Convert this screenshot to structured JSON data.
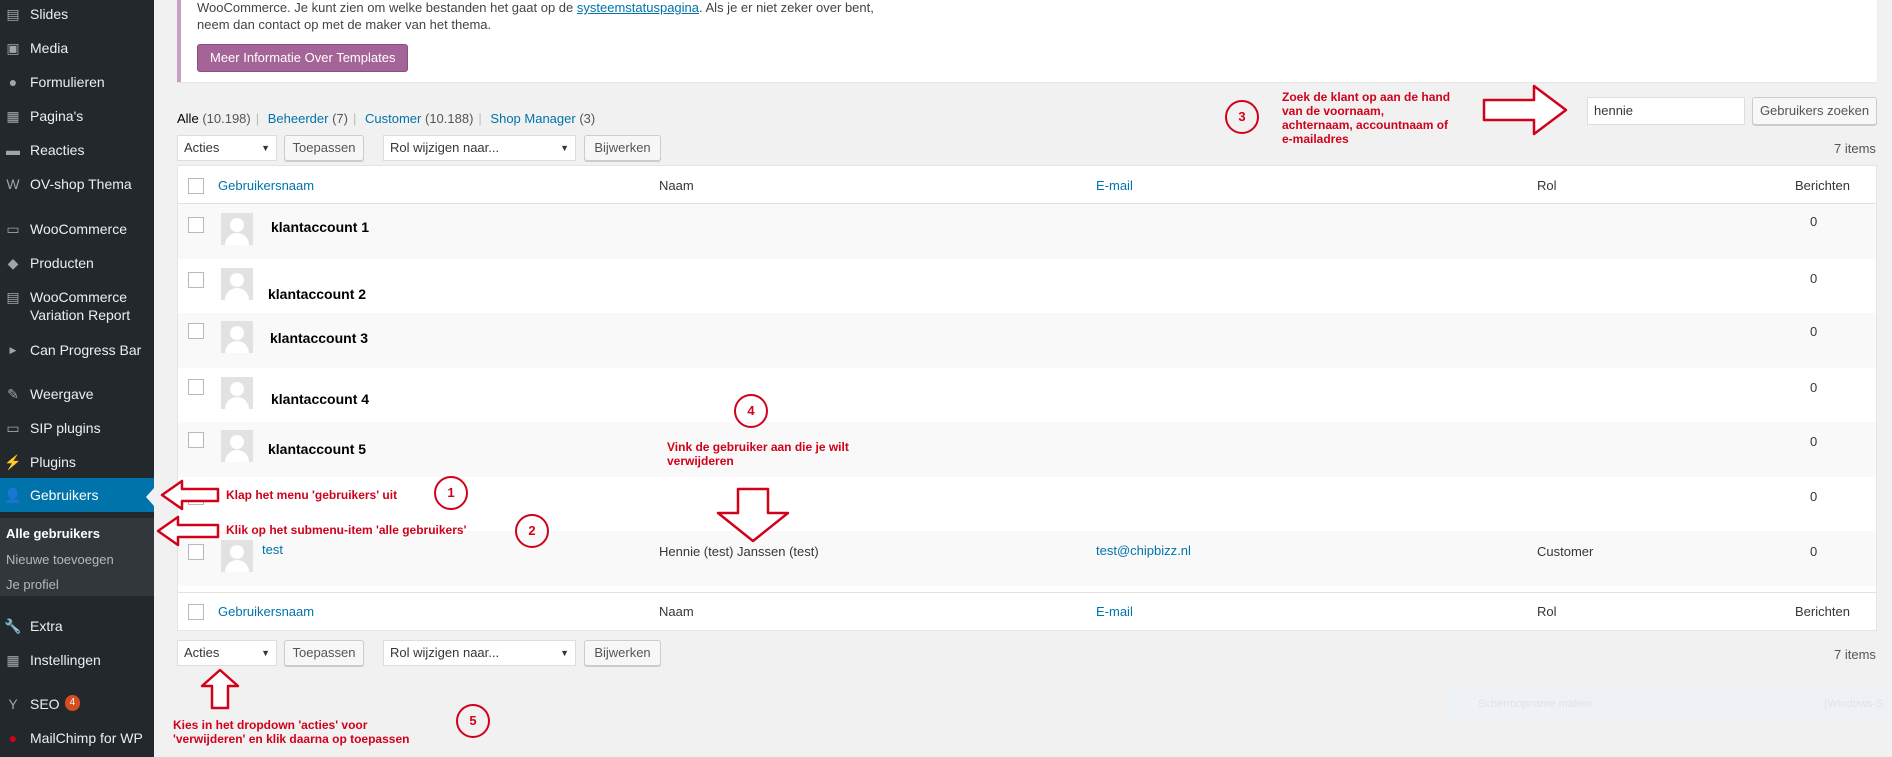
{
  "sidebar": {
    "items": [
      {
        "label": "Slides",
        "icon": "slides-icon"
      },
      {
        "label": "Media",
        "icon": "media-icon"
      },
      {
        "label": "Formulieren",
        "icon": "forms-icon"
      },
      {
        "label": "Pagina's",
        "icon": "pages-icon"
      },
      {
        "label": "Reacties",
        "icon": "comments-icon"
      },
      {
        "label": "OV-shop Thema",
        "icon": "theme-icon"
      },
      {
        "label": "WooCommerce",
        "icon": "woocommerce-icon"
      },
      {
        "label": "Producten",
        "icon": "products-icon"
      },
      {
        "label": "WooCommerce Variation Report",
        "icon": "report-icon"
      },
      {
        "label": "Can Progress Bar",
        "icon": "progress-icon"
      },
      {
        "label": "Weergave",
        "icon": "appearance-icon"
      },
      {
        "label": "SIP plugins",
        "icon": "sip-icon"
      },
      {
        "label": "Plugins",
        "icon": "plugins-icon"
      },
      {
        "label": "Gebruikers",
        "icon": "users-icon"
      },
      {
        "label": "Extra",
        "icon": "tools-icon"
      },
      {
        "label": "Instellingen",
        "icon": "settings-icon"
      },
      {
        "label": "SEO",
        "icon": "seo-icon",
        "badge": "4"
      },
      {
        "label": "MailChimp for WP",
        "icon": "mailchimp-icon"
      }
    ],
    "submenu": [
      "Alle gebruikers",
      "Nieuwe toevoegen",
      "Je profiel"
    ]
  },
  "notice": {
    "line1_before": "WooCommerce. Je kunt zien om welke bestanden het gaat op de ",
    "line1_link": "systeemstatuspagina",
    "line1_after": ". Als je er niet zeker over bent,",
    "line2": "neem dan contact op met de maker van het thema.",
    "button": "Meer Informatie Over Templates"
  },
  "filters": {
    "all": "Alle",
    "all_count": "(10.198)",
    "admin": "Beheerder",
    "admin_count": "(7)",
    "customer": "Customer",
    "customer_count": "(10.188)",
    "shop_manager": "Shop Manager",
    "shop_manager_count": "(3)"
  },
  "bulk": {
    "actions": "Acties",
    "apply": "Toepassen",
    "role": "Rol wijzigen naar...",
    "update": "Bijwerken",
    "items": "7 items"
  },
  "search": {
    "value": "hennie",
    "button": "Gebruikers zoeken"
  },
  "table": {
    "headers": {
      "username": "Gebruikersnaam",
      "name": "Naam",
      "email": "E-mail",
      "role": "Rol",
      "posts": "Berichten"
    },
    "rows": [
      {
        "username": "klantaccount 1",
        "name": "",
        "email": "",
        "role": "",
        "posts": "0"
      },
      {
        "username": "klantaccount 2",
        "name": "",
        "email": "",
        "role": "",
        "posts": "0"
      },
      {
        "username": "klantaccount 3",
        "name": "",
        "email": "",
        "role": "",
        "posts": "0"
      },
      {
        "username": "klantaccount 4",
        "name": "",
        "email": "",
        "role": "",
        "posts": "0"
      },
      {
        "username": "klantaccount 5",
        "name": "",
        "email": "",
        "role": "",
        "posts": "0"
      },
      {
        "username": "",
        "name": "",
        "email": "",
        "role": "",
        "posts": "0"
      },
      {
        "username": "test",
        "name": "Hennie (test) Janssen (test)",
        "email": "test@chipbizz.nl",
        "role": "Customer",
        "posts": "0"
      }
    ]
  },
  "annotations": {
    "step1": {
      "num": "1",
      "text": "Klap het menu 'gebruikers' uit"
    },
    "step2": {
      "num": "2",
      "text": "Klik op het submenu-item 'alle gebruikers'"
    },
    "step3": {
      "num": "3",
      "text_l1": "Zoek de klant op aan de hand",
      "text_l2": "van de voornaam,",
      "text_l3": "achternaam, accountnaam of",
      "text_l4": "e-mailadres"
    },
    "step4": {
      "num": "4",
      "text_l1": "Vink de gebruiker aan die je wilt",
      "text_l2": "verwijderen"
    },
    "step5": {
      "num": "5",
      "text_l1": "Kies in het dropdown 'acties' voor",
      "text_l2": "'verwijderen' en klik daarna op toepassen"
    },
    "color": "#d0021b"
  },
  "faint_overlay": {
    "left": "Schermopname maken",
    "right": "(Windows-S"
  }
}
